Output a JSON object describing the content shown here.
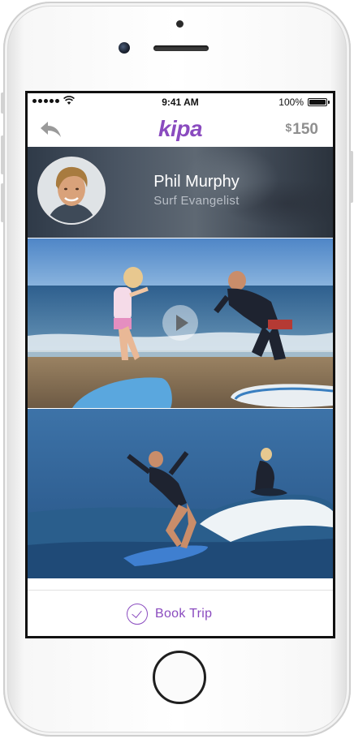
{
  "status_bar": {
    "time": "9:41 AM",
    "battery_percent": "100%"
  },
  "nav": {
    "logo": "kipa",
    "price_currency": "$",
    "price_amount": "150"
  },
  "profile": {
    "name": "Phil Murphy",
    "role": "Surf Evangelist"
  },
  "media": [
    {
      "kind": "video",
      "icon": "play-icon"
    },
    {
      "kind": "photo"
    }
  ],
  "footer": {
    "book_label": "Book Trip",
    "book_icon": "check-circle-icon"
  },
  "colors": {
    "accent": "#8a4bbf",
    "price": "#8f8f8f",
    "profile_text": "#ffffff",
    "profile_subtext": "#b8bec6"
  }
}
